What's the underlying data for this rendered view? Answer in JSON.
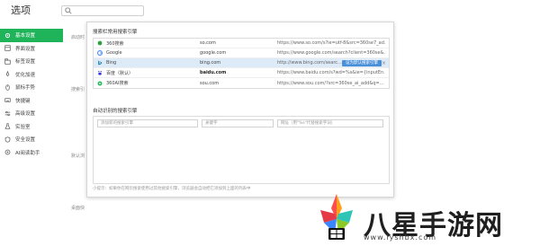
{
  "app": {
    "title": "选项"
  },
  "search": {
    "placeholder": "",
    "value": ""
  },
  "sidebar": {
    "items": [
      {
        "label": "基本设置",
        "icon": "gear-icon",
        "active": true
      },
      {
        "label": "界面设置",
        "icon": "layout-icon"
      },
      {
        "label": "标签设置",
        "icon": "tab-icon"
      },
      {
        "label": "优化加速",
        "icon": "rocket-icon"
      },
      {
        "label": "鼠标手势",
        "icon": "mouse-icon"
      },
      {
        "label": "快捷键",
        "icon": "keyboard-icon"
      },
      {
        "label": "高级设置",
        "icon": "sliders-icon"
      },
      {
        "label": "实验室",
        "icon": "flask-icon"
      },
      {
        "label": "安全设置",
        "icon": "shield-icon"
      },
      {
        "label": "AI阅读助手",
        "icon": "ai-icon"
      }
    ]
  },
  "sections": [
    {
      "label": "启动时"
    },
    {
      "label": "搜索引"
    },
    {
      "label": "默认浏"
    },
    {
      "label": "桌面快"
    }
  ],
  "dialog": {
    "common_title": "搜索栏常用搜索引擎",
    "auto_title": "自动识别的搜索引擎",
    "engines": [
      {
        "name": "360搜索",
        "keyword": "so.com",
        "url": "https://www.so.com/s?ie=utf-8&src=360se7_ad...",
        "icon": "so-icon",
        "color": "#2ea043"
      },
      {
        "name": "Google",
        "keyword": "google.com",
        "url": "https://www.google.com/search?client=360se&...",
        "icon": "google-icon",
        "color": "#4285f4"
      },
      {
        "name": "Bing",
        "keyword": "bing.com",
        "url": "http://www.bing.com/searc...",
        "icon": "bing-icon",
        "color": "#0b7ea8",
        "selected": true
      },
      {
        "name": "百度（默认）",
        "keyword": "baidu.com",
        "url": "https://www.baidu.com/s?wd=%s&ie={inputEn...",
        "icon": "baidu-icon",
        "color": "#2932e1",
        "bold": true
      },
      {
        "name": "360AI搜索",
        "keyword": "sou.com",
        "url": "https://www.sou.com/?src=360se_ai_add&q=...",
        "icon": "ai-search-icon",
        "color": "#19b955"
      }
    ],
    "default_button": "设为默认搜索引擎",
    "delete_glyph": "×",
    "auto_placeholders": {
      "name": "添加新的搜索引擎",
      "keyword": "关键字",
      "url": "网址（用\"%s\"代替搜索字词）"
    },
    "tip": "小提示：如果你在网页搜索使用过其他搜索引擎，浏览器会自动把它添加到上面的列表中"
  },
  "watermark": {
    "text": "八星手游网",
    "url": "www.lyshbx.com"
  }
}
